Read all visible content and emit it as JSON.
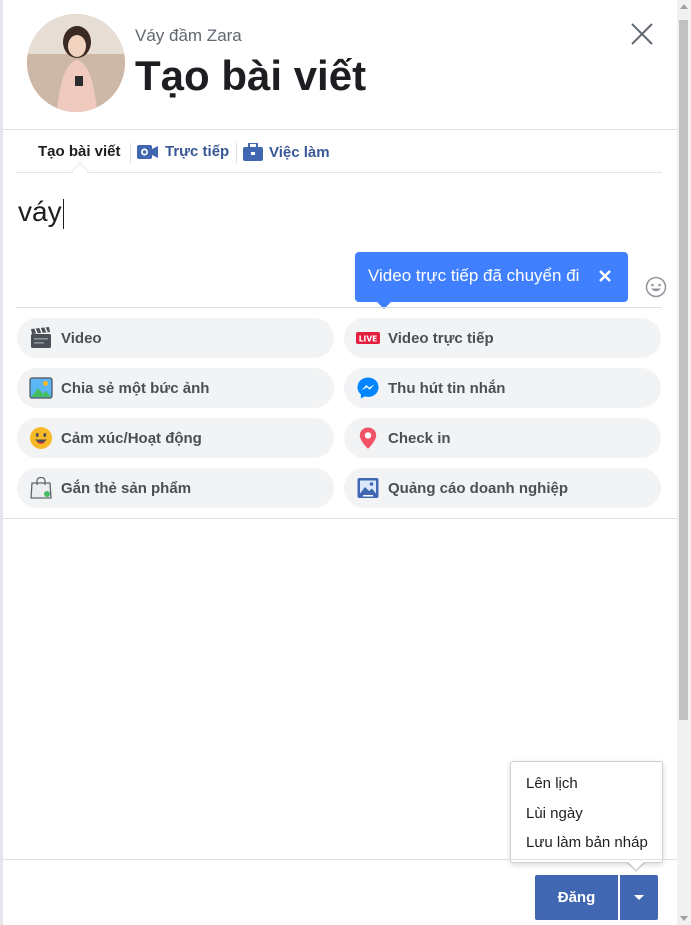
{
  "header": {
    "page_name": "Váy đầm Zara",
    "title": "Tạo bài viết"
  },
  "tabs": [
    {
      "label": "Tạo bài viết",
      "icon": "none"
    },
    {
      "label": "Trực tiếp",
      "icon": "video-camera-icon"
    },
    {
      "label": "Việc làm",
      "icon": "briefcase-icon"
    }
  ],
  "composer": {
    "text": "váy"
  },
  "tooltip": {
    "text": "Video trực tiếp đã chuyển đi"
  },
  "actions": [
    {
      "label": "Video",
      "icon": "video-clapper-icon"
    },
    {
      "label": "Video trực tiếp",
      "icon": "live-badge-icon"
    },
    {
      "label": "Chia sẻ một bức ảnh",
      "icon": "photo-icon"
    },
    {
      "label": "Thu hút tin nhắn",
      "icon": "messenger-icon"
    },
    {
      "label": "Cảm xúc/Hoạt động",
      "icon": "smiley-icon"
    },
    {
      "label": "Check in",
      "icon": "location-pin-icon"
    },
    {
      "label": "Gắn thẻ sản phẩm",
      "icon": "shopping-bag-icon"
    },
    {
      "label": "Quảng cáo doanh nghiệp",
      "icon": "business-ad-icon"
    }
  ],
  "dropdown": {
    "items": [
      "Lên lịch",
      "Lùi ngày",
      "Lưu làm bản nháp"
    ]
  },
  "footer": {
    "post_label": "Đăng"
  },
  "colors": {
    "brand": "#4267b2",
    "link": "#385898",
    "tooltip": "#4080ff",
    "live": "#e41e3f"
  }
}
